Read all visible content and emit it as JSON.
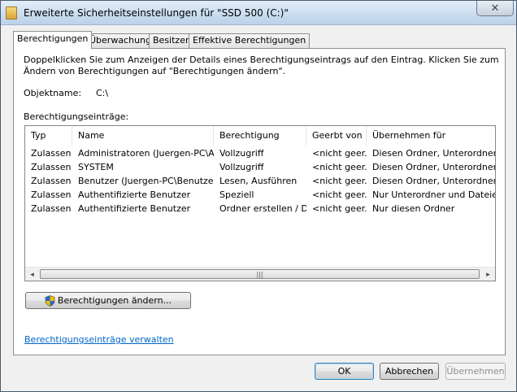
{
  "window": {
    "title": "Erweiterte Sicherheitseinstellungen für \"SSD 500 (C:)\"",
    "close_glyph": "✕"
  },
  "tabs": [
    {
      "label": "Berechtigungen",
      "active": true
    },
    {
      "label": "Überwachung"
    },
    {
      "label": "Besitzer"
    },
    {
      "label": "Effektive Berechtigungen"
    }
  ],
  "panel": {
    "description": "Doppelklicken Sie zum Anzeigen der Details eines Berechtigungseintrags auf den Eintrag. Klicken Sie zum Ändern von Berechtigungen auf \"Berechtigungen ändern\".",
    "object_label": "Objektname:",
    "object_value": "C:\\",
    "entries_label": "Berechtigungseinträge:",
    "columns": [
      "Typ",
      "Name",
      "Berechtigung",
      "Geerbt von",
      "Übernehmen für"
    ],
    "rows": [
      [
        "Zulassen",
        "Administratoren (Juergen-PC\\Ad...",
        "Vollzugriff",
        "<nicht geer...",
        "Diesen Ordner, Unterordner und"
      ],
      [
        "Zulassen",
        "SYSTEM",
        "Vollzugriff",
        "<nicht geer...",
        "Diesen Ordner, Unterordner und"
      ],
      [
        "Zulassen",
        "Benutzer (Juergen-PC\\Benutzer)",
        "Lesen, Ausführen",
        "<nicht geer...",
        "Diesen Ordner, Unterordner und"
      ],
      [
        "Zulassen",
        "Authentifizierte Benutzer",
        "Speziell",
        "<nicht geer...",
        "Nur Unterordner und Dateien"
      ],
      [
        "Zulassen",
        "Authentifizierte Benutzer",
        "Ordner erstellen / D...",
        "<nicht geer...",
        "Nur diesen Ordner"
      ]
    ],
    "scroll_left": "◂",
    "scroll_right": "▸",
    "scroll_grip": "|||",
    "change_button": "Berechtigungen ändern...",
    "manage_link": "Berechtigungseinträge verwalten"
  },
  "footer": {
    "ok": "OK",
    "cancel": "Abbrechen",
    "apply": "Übernehmen"
  },
  "colors": {
    "link": "#0066cc",
    "accent": "#3c7fb1"
  }
}
